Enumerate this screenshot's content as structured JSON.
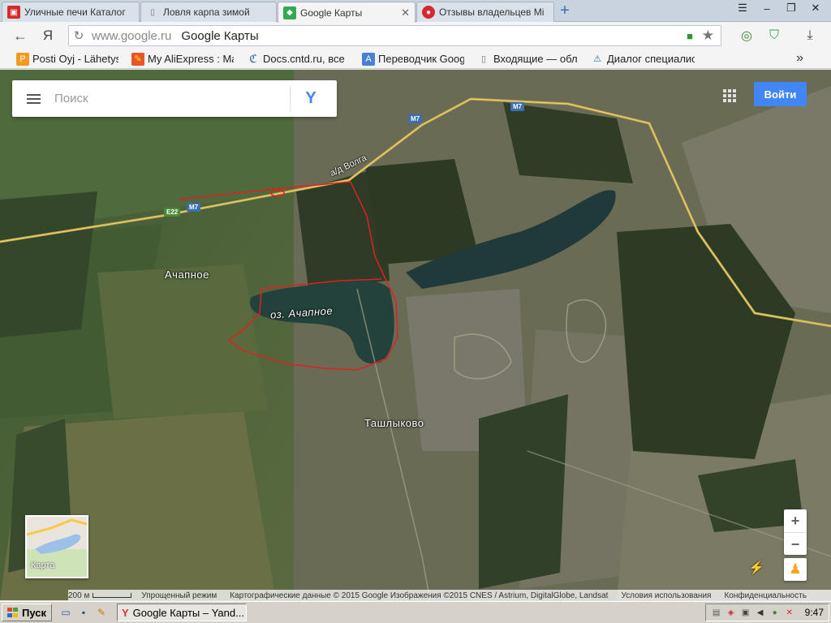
{
  "browser": {
    "tabs": [
      {
        "title": "Уличные печи Каталог",
        "icon": "bag-icon",
        "active": false
      },
      {
        "title": "Ловля карпа зимой",
        "icon": "page-icon",
        "active": false
      },
      {
        "title": "Google Карты",
        "icon": "google-maps-icon",
        "active": true
      },
      {
        "title": "Отзывы владельцев Мі",
        "icon": "review-icon",
        "active": false
      }
    ],
    "new_tab_symbol": "+",
    "window_buttons": {
      "menu": "☰",
      "minimize": "–",
      "restore": "❐",
      "close": "✕"
    },
    "address": {
      "host": "www.google.ru",
      "page_title": "Google Карты"
    },
    "bookmarks": [
      {
        "label": "Posti Oyj - Lähetys",
        "icon": "posti-icon"
      },
      {
        "label": "My AliExpress : Ma",
        "icon": "aliexpress-icon"
      },
      {
        "label": "Docs.cntd.ru, все",
        "icon": "docs-icon"
      },
      {
        "label": "Переводчик Googl",
        "icon": "translate-icon"
      },
      {
        "label": "Входящие — обле",
        "icon": "page-icon"
      },
      {
        "label": "Диалог специалис",
        "icon": "dialog-icon"
      }
    ],
    "bookmarks_more": "»"
  },
  "map": {
    "search": {
      "placeholder": "Поиск"
    },
    "signin_label": "Войти",
    "minimap_label": "Карта",
    "zoom_in": "+",
    "zoom_out": "−",
    "places": {
      "village_1": "Ачапное",
      "lake": "оз. Ачапное",
      "village_2": "Ташлыково"
    },
    "roads": {
      "highway_label": "а/д Волга",
      "shield_m7": "M7",
      "shield_e22": "E22"
    },
    "footer": {
      "scale": "200 м",
      "lite_mode": "Упрощенный режим",
      "attribution": "Картографические данные © 2015 Google Изображения ©2015 CNES / Astrium, DigitalGlobe, Landsat",
      "terms": "Условия использования",
      "privacy": "Конфиденциальность"
    },
    "colors": {
      "annotation": "#e02020",
      "road": "#f0d060",
      "accent": "#4285f4"
    }
  },
  "taskbar": {
    "start_label": "Пуск",
    "task_item": "Google Карты – Yand...",
    "clock": "9:47"
  }
}
